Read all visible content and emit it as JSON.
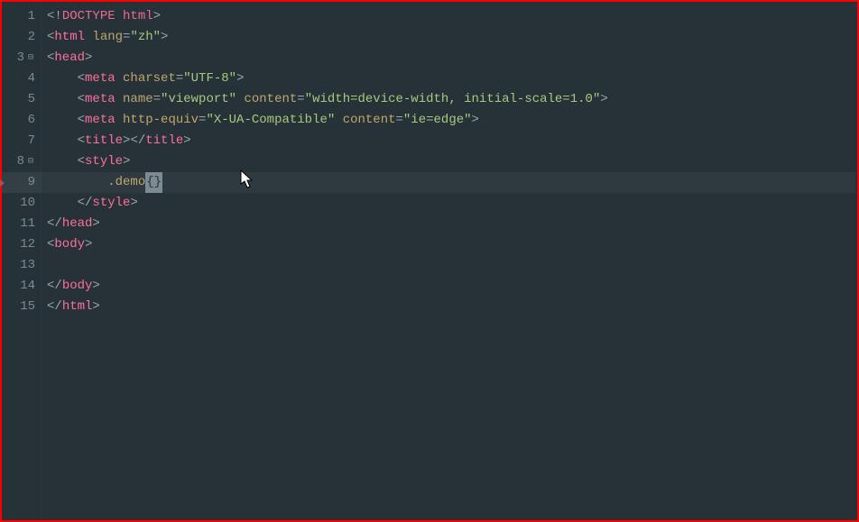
{
  "lines": {
    "1": {
      "num": "1"
    },
    "2": {
      "num": "2"
    },
    "3": {
      "num": "3"
    },
    "4": {
      "num": "4"
    },
    "5": {
      "num": "5"
    },
    "6": {
      "num": "6"
    },
    "7": {
      "num": "7"
    },
    "8": {
      "num": "8"
    },
    "9": {
      "num": "9"
    },
    "10": {
      "num": "10"
    },
    "11": {
      "num": "11"
    },
    "12": {
      "num": "12"
    },
    "13": {
      "num": "13"
    },
    "14": {
      "num": "14"
    },
    "15": {
      "num": "15"
    }
  },
  "tok": {
    "lt": "<",
    "gt": ">",
    "lts": "</",
    "excl": "<!",
    "doctype": "DOCTYPE",
    "htmlw": "html",
    "html": "html",
    "head": "head",
    "meta": "meta",
    "title": "title",
    "style": "style",
    "body": "body",
    "lang": "lang",
    "charset": "charset",
    "name": "name",
    "content": "content",
    "httpequiv": "http-equiv",
    "zh": "\"zh\"",
    "utf8": "\"UTF-8\"",
    "viewport": "\"viewport\"",
    "vpcontent": "\"width=device-width, initial-scale=1.0\"",
    "xua": "\"X-UA-Compatible\"",
    "ieedge": "\"ie=edge\"",
    "eq": "=",
    "sp": " ",
    "demo": ".demo",
    "lbr": "{",
    "rbr": "}"
  },
  "indent": {
    "i1": "    ",
    "i2": "        "
  }
}
